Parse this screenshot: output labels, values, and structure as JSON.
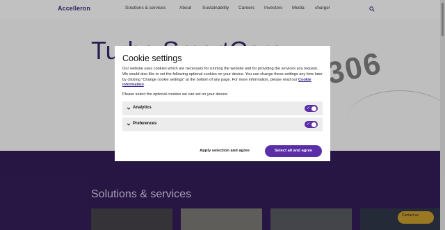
{
  "nav": {
    "logo": "Accelleron",
    "links": [
      "Solutions & services",
      "About",
      "Sustainability",
      "Careers",
      "Investors",
      "Media",
      "charge!"
    ]
  },
  "hero": {
    "title": "Turbo SmartCare",
    "number": "306"
  },
  "solutions": {
    "title": "Solutions & services"
  },
  "chat": {
    "label": "Contact us"
  },
  "modal": {
    "title": "Cookie settings",
    "text_before_link": "Our website uses cookies which are necessary for running the website and for providing the services you request. We would also like to set the following optional cookies on your device. You can change these settings any time later by clicking \"Change cookie settings\" at the bottom of any page. For more information, please read our ",
    "link_text": "Cookie information",
    "text_after_link": ".",
    "select_prompt": "Please select the optional cookies we can set on your device:",
    "options": [
      {
        "label": "Analytics",
        "enabled": true
      },
      {
        "label": "Preferences",
        "enabled": true
      }
    ],
    "apply_label": "Apply selection and agree",
    "select_all_label": "Select all and agree"
  },
  "colors": {
    "accent": "#5a2ea6",
    "brand_dark": "#2d1a4d"
  }
}
